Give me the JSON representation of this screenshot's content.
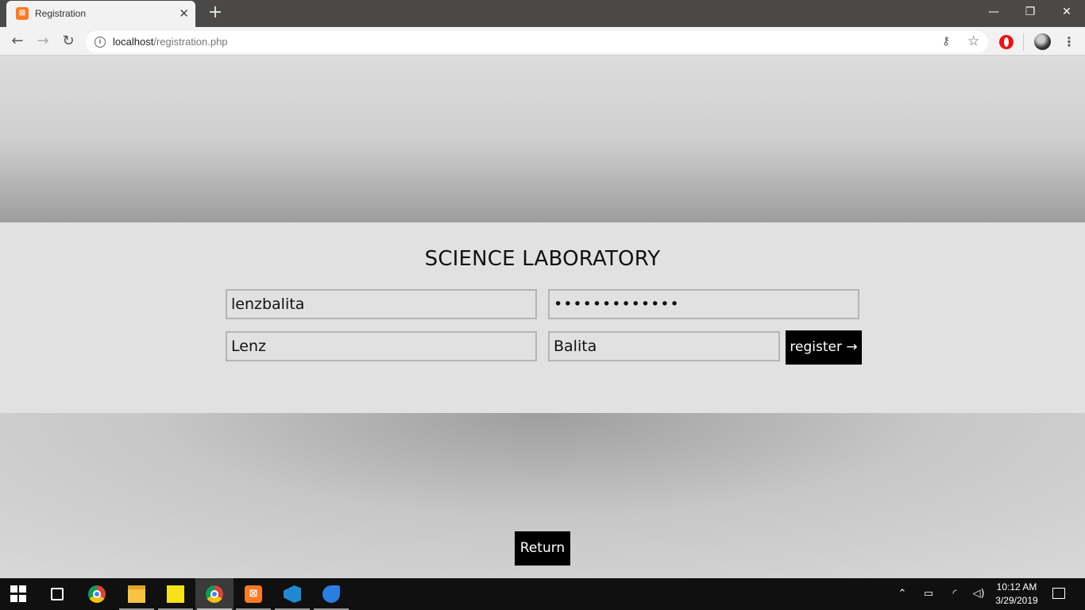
{
  "browser": {
    "tab_title": "Registration",
    "tab_close": "✕",
    "new_tab": "+",
    "url_host": "localhost",
    "url_path": "/registration.php",
    "window_controls": {
      "minimize": "—",
      "maximize": "❐",
      "close": "✕"
    },
    "icons": [
      "back-arrow-icon",
      "forward-arrow-icon",
      "reload-icon",
      "info-icon",
      "key-icon",
      "star-icon",
      "opera-icon",
      "avatar",
      "menu-dots-icon"
    ]
  },
  "form": {
    "title": "SCIENCE LABORATORY",
    "username": "lenzbalita",
    "password": "•••••••••••••",
    "first_name": "Lenz",
    "last_name": "Balita",
    "register_label": "register →"
  },
  "return_label": "Return",
  "taskbar": {
    "clock_time": "10:12 AM",
    "clock_date": "3/29/2019",
    "apps": [
      "start",
      "task-view",
      "chrome",
      "file-explorer",
      "sticky-notes",
      "chrome-profile",
      "xampp",
      "vscode",
      "dolphin"
    ]
  },
  "colors": {
    "page_bg": "#dcdcdc",
    "panel_bg": "#e1e1e1",
    "button_bg": "#000000",
    "xampp_orange": "#fb7a24"
  }
}
